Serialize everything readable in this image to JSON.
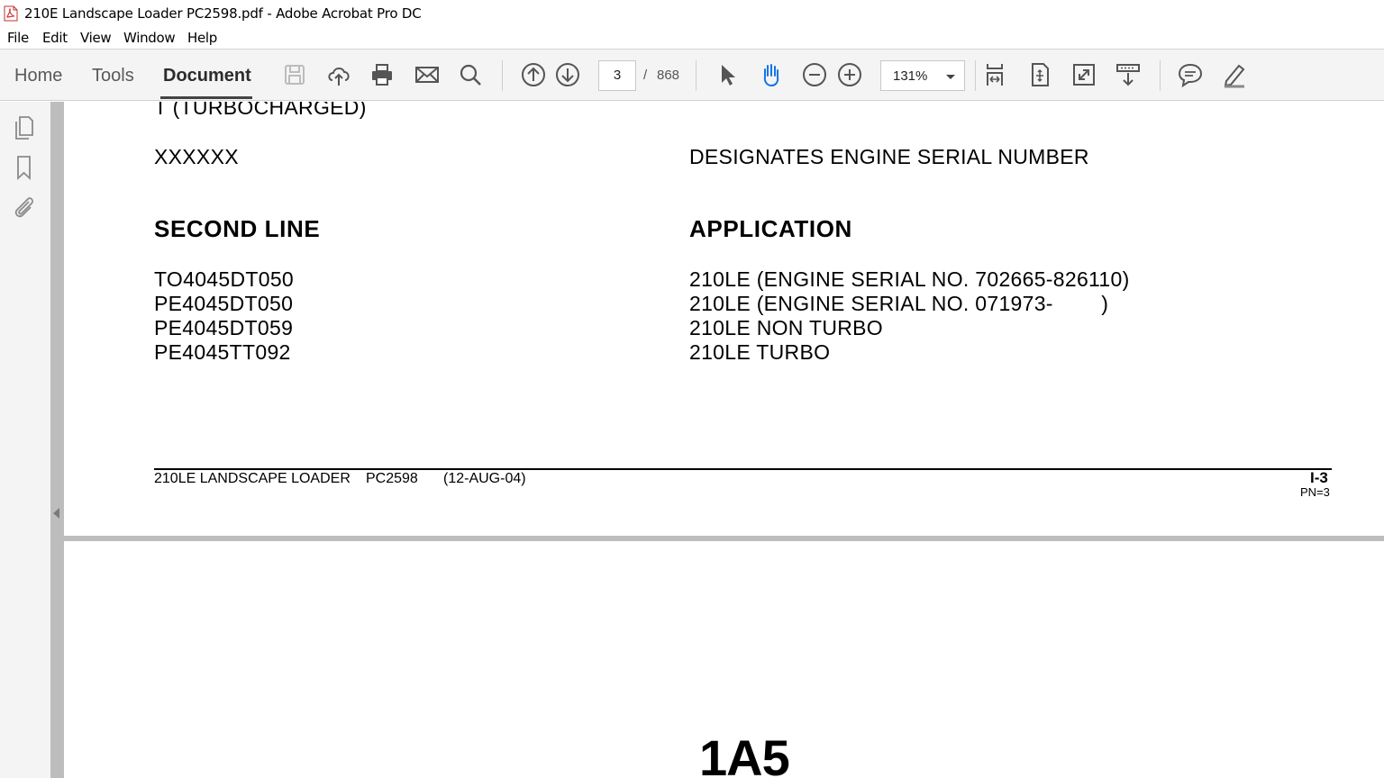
{
  "window": {
    "title": "210E Landscape Loader PC2598.pdf - Adobe Acrobat Pro DC",
    "app_icon": "pdf-file-icon"
  },
  "menu": [
    "File",
    "Edit",
    "View",
    "Window",
    "Help"
  ],
  "toolbar": {
    "tabs": [
      "Home",
      "Tools",
      "Document"
    ],
    "active_tab": "Document",
    "page_current": "3",
    "page_separator": "/",
    "page_total": "868",
    "zoom": "131%",
    "icons": [
      "save-icon",
      "cloud-upload-icon",
      "print-icon",
      "email-icon",
      "search-icon",
      "previous-page-icon",
      "next-page-icon",
      "select-pointer-icon",
      "hand-tool-icon",
      "zoom-out-icon",
      "zoom-in-icon",
      "scroll-mode-icon",
      "fit-page-icon",
      "full-screen-icon",
      "read-mode-icon",
      "comment-icon",
      "highlight-pen-icon"
    ]
  },
  "leftnav": {
    "icons": [
      "page-thumbnails-icon",
      "bookmarks-icon",
      "attachments-icon"
    ]
  },
  "document": {
    "top_partial": "T (TURBOCHARGED)",
    "serial_code": "XXXXXX",
    "serial_desc": "DESIGNATES ENGINE SERIAL NUMBER",
    "col1_heading": "SECOND LINE",
    "col2_heading": "APPLICATION",
    "rows": [
      {
        "code": "TO4045DT050",
        "application": "210LE (ENGINE SERIAL NO. 702665-826110)"
      },
      {
        "code": "PE4045DT050",
        "application": "210LE (ENGINE SERIAL NO. 071973-        )"
      },
      {
        "code": "PE4045DT059",
        "application": "210LE NON TURBO"
      },
      {
        "code": "PE4045TT092",
        "application": "210LE TURBO"
      }
    ],
    "footer_title": "210LE LANDSCAPE LOADER",
    "footer_pc": "PC2598",
    "footer_date": "(12-AUG-04)",
    "footer_page": "I-3",
    "footer_pn": "PN=3",
    "next_page_code": "1A5"
  },
  "colors": {
    "toolbar_bg": "#f4f4f4",
    "splitter": "#bdbdbd",
    "pdf_red": "#d8262b"
  }
}
